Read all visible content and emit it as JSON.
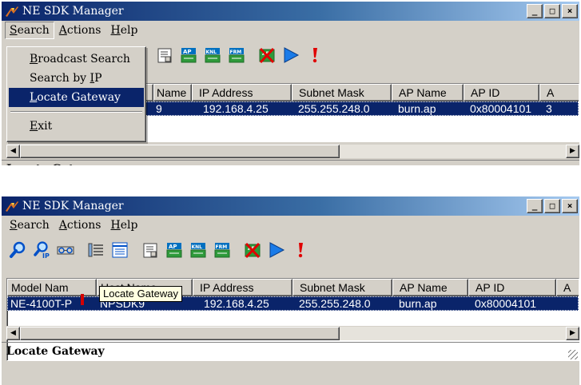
{
  "app": {
    "title": "NE SDK Manager"
  },
  "menus": {
    "search_pre": "",
    "search_ul": "S",
    "search_post": "earch",
    "actions_pre": "",
    "actions_ul": "A",
    "actions_post": "ctions",
    "help_pre": "",
    "help_ul": "H",
    "help_post": "elp"
  },
  "search_menu": {
    "broadcast": {
      "ul": "B",
      "post": "roadcast Search"
    },
    "by_ip": {
      "pre": "Search by ",
      "ul": "I",
      "post": "P"
    },
    "locate": {
      "ul": "L",
      "post": "ocate Gateway"
    },
    "exit": {
      "ul": "E",
      "post": "xit"
    }
  },
  "toolbar_icons": [
    "search-icon",
    "search-ip-icon",
    "locate-gateway-icon",
    "view-list-icon",
    "view-details-icon",
    "properties-icon",
    "upload-ap-icon",
    "upload-kernel-icon",
    "upload-firmware-icon",
    "delete-ap-icon",
    "run-icon",
    "alert-icon"
  ],
  "table": {
    "headers_top": [
      "Name",
      "IP Address",
      "Subnet Mask",
      "AP Name",
      "AP ID",
      "A"
    ],
    "row_top": [
      "9",
      "192.168.4.25",
      "255.255.248.0",
      "burn.ap",
      "0x80004101",
      "3"
    ],
    "headers_bottom": [
      "Model Nam",
      "Host Name",
      "IP Address",
      "Subnet Mask",
      "AP Name",
      "AP ID",
      "A"
    ],
    "row_bottom": [
      "NE-4100T-P",
      "NPSDK9",
      "192.168.4.25",
      "255.255.248.0",
      "burn.ap",
      "0x80004101",
      ""
    ]
  },
  "status": {
    "text": "Locate Gateway"
  },
  "tooltip": {
    "text": "Locate Gateway"
  },
  "colors": {
    "title_start": "#0a246a",
    "title_end": "#a6caf0",
    "selection": "#0a246a",
    "face": "#d4d0c8",
    "tooltip_bg": "#ffffe1"
  }
}
